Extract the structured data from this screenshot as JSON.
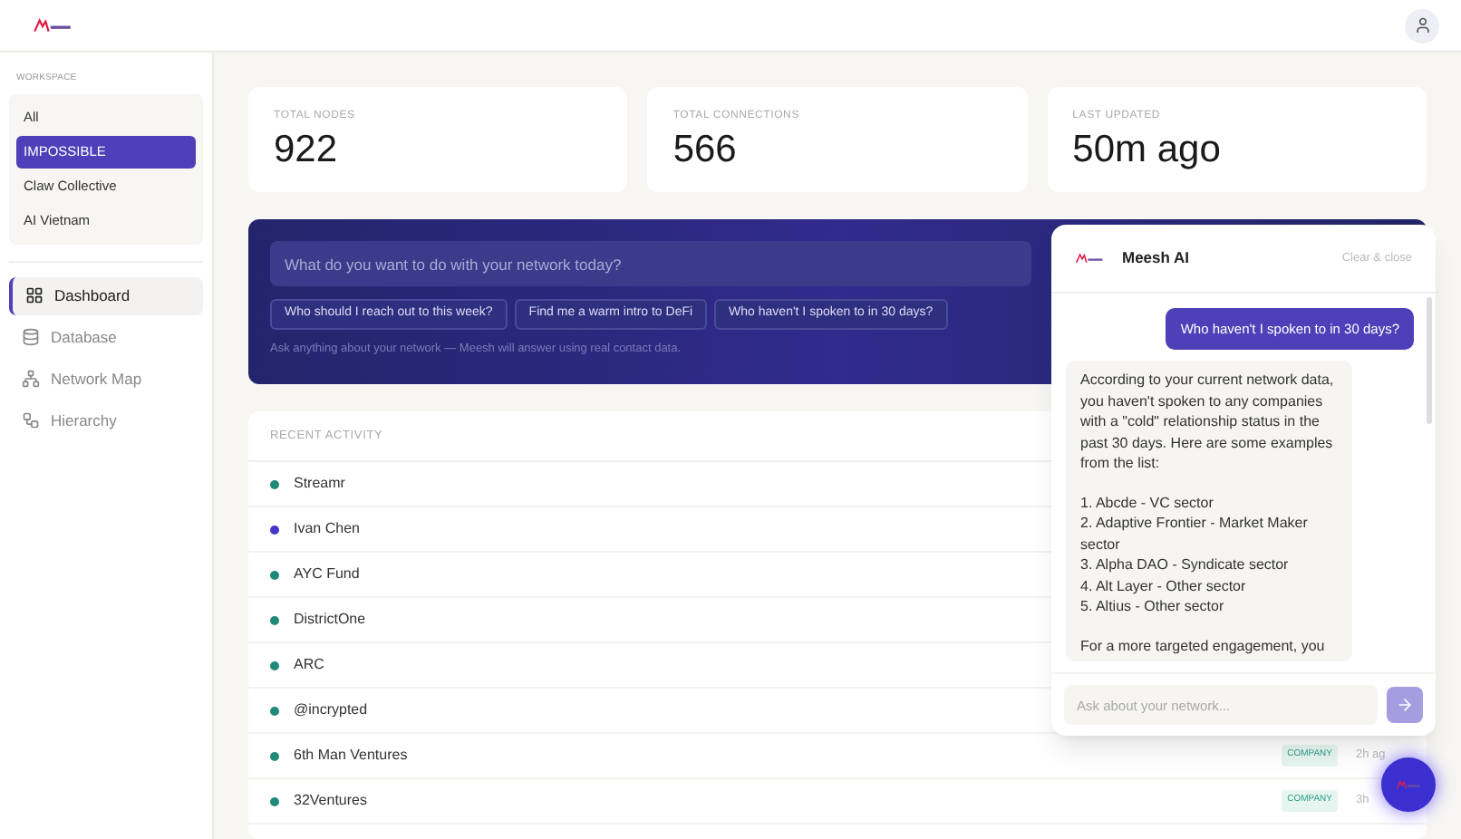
{
  "sidebar": {
    "section_label": "WORKSPACE",
    "workspaces": [
      {
        "label": "All",
        "selected": false
      },
      {
        "label": "IMPOSSIBLE",
        "selected": true
      },
      {
        "label": "Claw Collective",
        "selected": false
      },
      {
        "label": "AI Vietnam",
        "selected": false
      }
    ],
    "nav": [
      {
        "label": "Dashboard",
        "selected": true
      },
      {
        "label": "Database",
        "selected": false
      },
      {
        "label": "Network Map",
        "selected": false
      },
      {
        "label": "Hierarchy",
        "selected": false
      }
    ]
  },
  "stats": [
    {
      "label": "TOTAL NODES",
      "value": "922"
    },
    {
      "label": "TOTAL CONNECTIONS",
      "value": "566"
    },
    {
      "label": "LAST UPDATED",
      "value": "50m ago"
    }
  ],
  "prompt": {
    "placeholder": "What do you want to do with your network today?",
    "suggestions": [
      "Who should I reach out to this week?",
      "Find me a warm intro to DeFi",
      "Who haven't I spoken to in 30 days?"
    ],
    "hint": "Ask anything about your network — Meesh will answer using real contact data."
  },
  "recent_activity": {
    "title": "RECENT ACTIVITY",
    "rows": [
      {
        "name": "Streamr",
        "color": "#1f8a78"
      },
      {
        "name": "Ivan Chen",
        "color": "#4338ca"
      },
      {
        "name": "AYC Fund",
        "color": "#1f8a78"
      },
      {
        "name": "DistrictOne",
        "color": "#1f8a78"
      },
      {
        "name": "ARC",
        "color": "#1f8a78"
      },
      {
        "name": "@incrypted",
        "color": "#1f8a78"
      },
      {
        "name": "6th Man Ventures",
        "color": "#1f8a78",
        "badge": "COMPANY",
        "time": "2h ag"
      },
      {
        "name": "32Ventures",
        "color": "#1f8a78",
        "badge": "COMPANY",
        "time": "3h"
      }
    ]
  },
  "chat": {
    "title": "Meesh AI",
    "close": "Clear & close",
    "messages": [
      {
        "kind": "user",
        "paragraphs": [
          "Who haven't I spoken to in 30 days?"
        ]
      },
      {
        "kind": "assistant",
        "paragraphs": [
          "According to your current network data, you haven't spoken to any companies with a \"cold\" relationship status in the past 30 days. Here are some examples from the list:",
          "1. Abcde - VC sector\n2. Adaptive Frontier - Market Maker sector\n3. Alpha DAO - Syndicate sector\n4. Alt Layer - Other sector\n5. Altius - Other sector",
          "For a more targeted engagement, you"
        ]
      }
    ],
    "input_placeholder": "Ask about your network..."
  }
}
